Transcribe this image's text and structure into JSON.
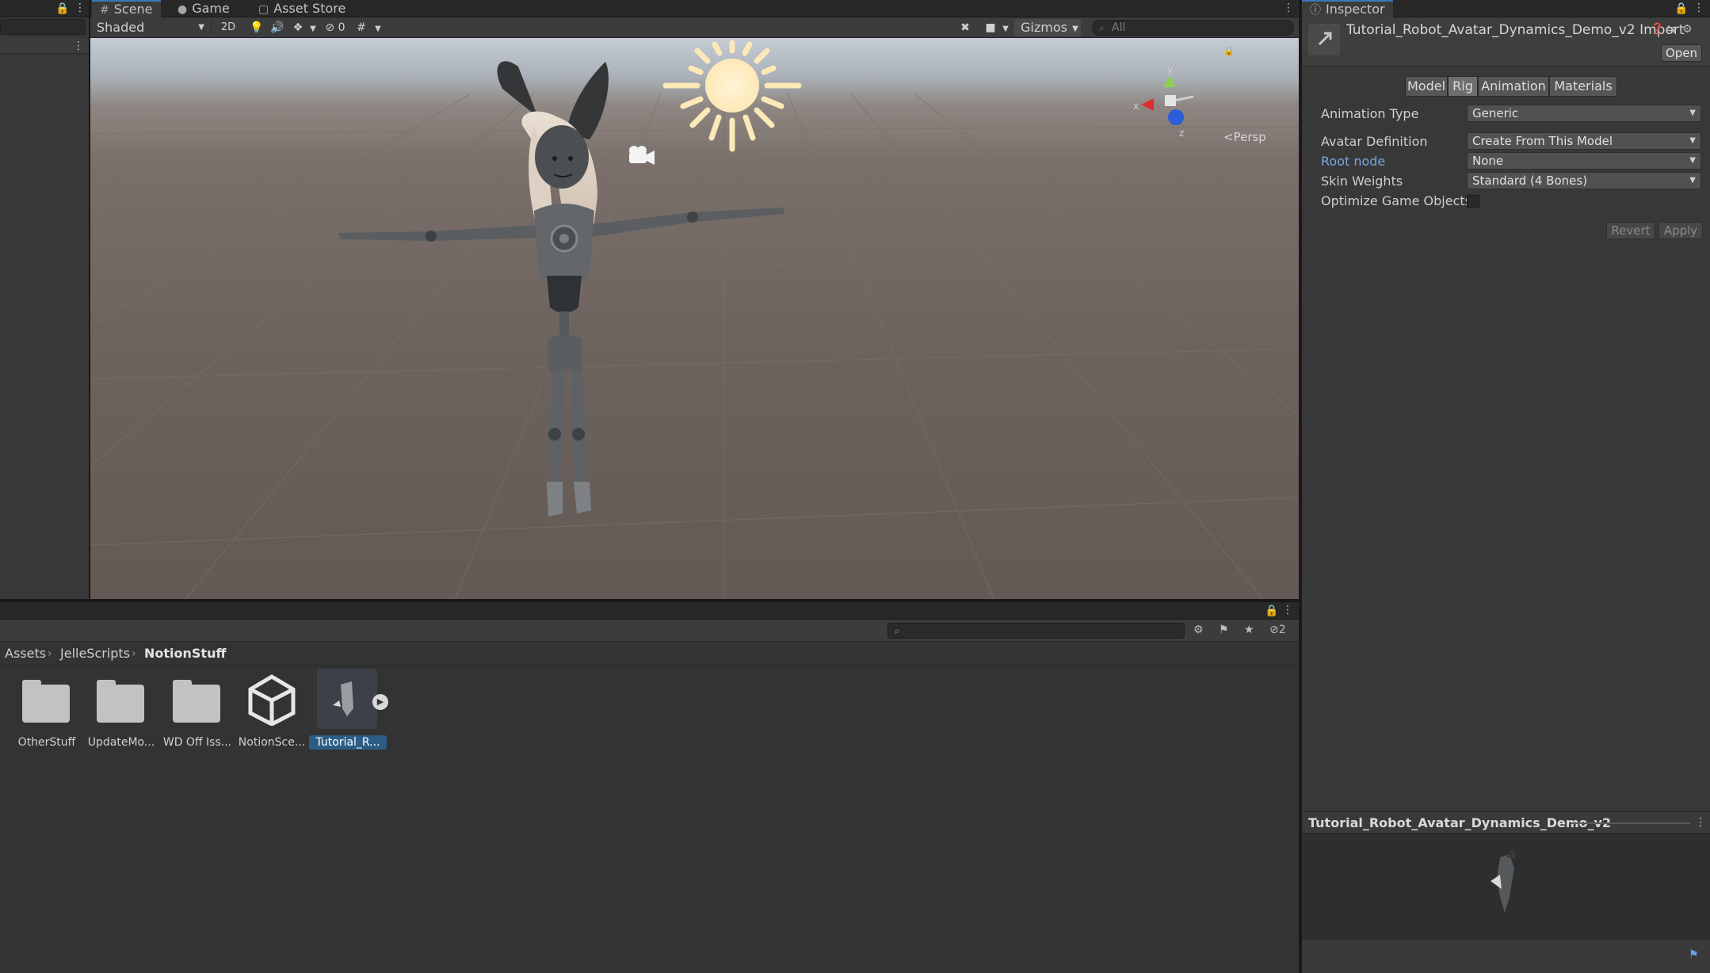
{
  "scene_tabs": [
    {
      "label": "Scene",
      "icon": "hash-icon"
    },
    {
      "label": "Game",
      "icon": "gamepad-icon"
    },
    {
      "label": "Asset Store",
      "icon": "bag-icon"
    }
  ],
  "scene_toolbar": {
    "shading_mode": "Shaded",
    "mode_2d": "2D",
    "hidden_count": "0",
    "gizmos_label": "Gizmos",
    "search_placeholder": "All"
  },
  "scene_view": {
    "projection_label": "Persp",
    "axis_labels": {
      "y": "y",
      "x": "x",
      "z": "z"
    }
  },
  "project": {
    "breadcrumb": [
      "Assets",
      "JelleScripts",
      "NotionStuff"
    ],
    "hidden_packages_count": "2",
    "assets": [
      {
        "name": "OtherStuff",
        "type": "folder",
        "selected": false
      },
      {
        "name": "UpdateMo...",
        "type": "folder",
        "selected": false
      },
      {
        "name": "WD Off Iss...",
        "type": "folder",
        "selected": false
      },
      {
        "name": "NotionSce...",
        "type": "scene",
        "selected": false
      },
      {
        "name": "Tutorial_R...",
        "type": "model",
        "selected": true
      }
    ]
  },
  "inspector": {
    "tab_label": "Inspector",
    "title": "Tutorial_Robot_Avatar_Dynamics_Demo_v2 Import",
    "open_label": "Open",
    "segments": [
      "Model",
      "Rig",
      "Animation",
      "Materials"
    ],
    "active_segment": "Rig",
    "properties": [
      {
        "label": "Animation Type",
        "value": "Generic",
        "kind": "dropdown"
      },
      {
        "label": "Avatar Definition",
        "value": "Create From This Model",
        "kind": "dropdown"
      },
      {
        "label": "Root node",
        "value": "None",
        "kind": "dropdown",
        "link": true
      },
      {
        "label": "Skin Weights",
        "value": "Standard (4 Bones)",
        "kind": "dropdown"
      },
      {
        "label": "Optimize Game Objects",
        "value": "",
        "kind": "checkbox"
      }
    ],
    "revert_label": "Revert",
    "apply_label": "Apply",
    "preview_title": "Tutorial_Robot_Avatar_Dynamics_Demo_v2"
  },
  "colors": {
    "accent": "#3a79bb",
    "selection": "#2c5d87",
    "link": "#7aa7e0",
    "sun": "#fde9b8"
  }
}
